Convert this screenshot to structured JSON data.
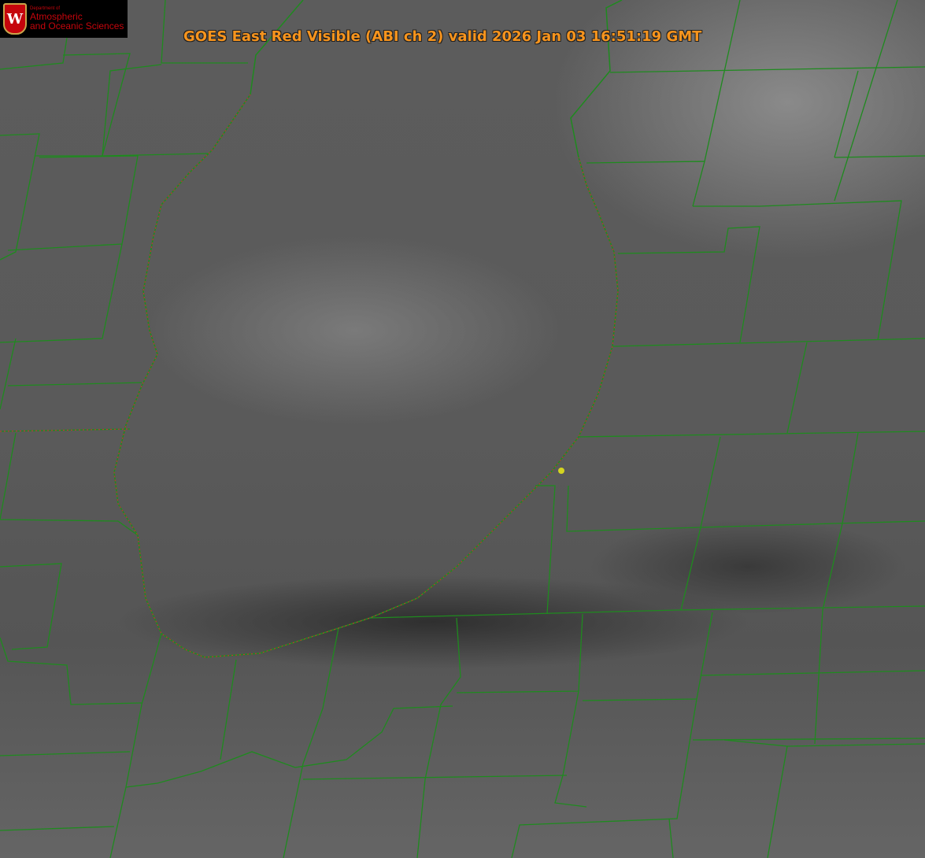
{
  "title": "GOES East Red Visible (ABI ch 2) valid 2026 Jan 03 16:51:19 GMT",
  "logo": {
    "line1": "Department of",
    "line2": "Atmospheric",
    "line3": "and Oceanic Sciences",
    "shield": "W"
  },
  "colors": {
    "boundary": "#1f8a1f",
    "shoreline_dash": "#d03030",
    "title": "#f7941d",
    "marker": "#d4d420"
  }
}
